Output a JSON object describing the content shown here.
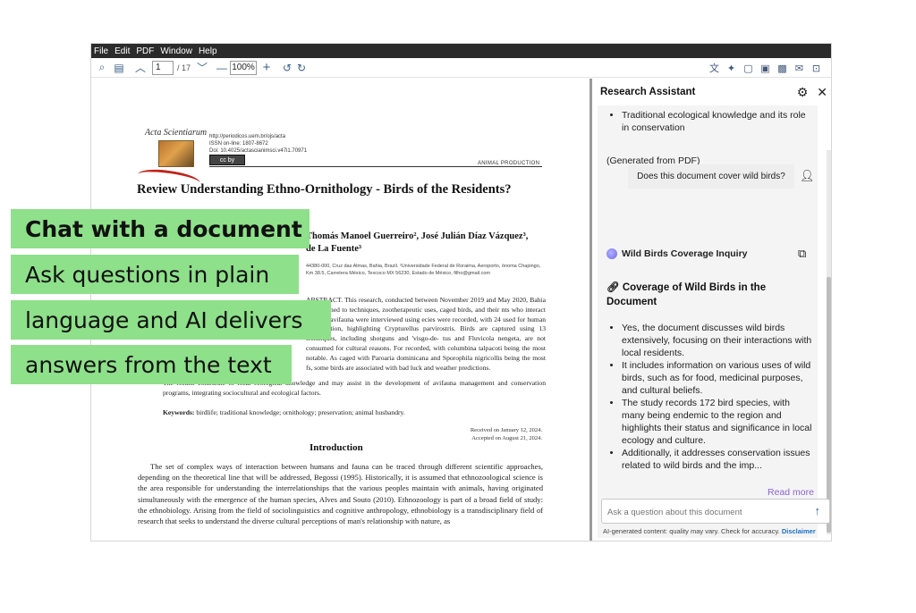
{
  "menu": [
    "File",
    "Edit",
    "PDF",
    "Window",
    "Help"
  ],
  "toolbar": {
    "page_current": "1",
    "page_total": "/ 17",
    "zoom": "100%"
  },
  "document": {
    "journal": "Acta Scientiarum",
    "meta_lines": [
      "http://periodicos.uem.br/ojs/acta",
      "ISSN on-line: 1807-8672",
      "Doi: 10.4025/actascianimsci.v47i1.70971"
    ],
    "cc_label": "cc  by",
    "section": "ANIMAL PRODUCTION",
    "title": "Review Understanding Ethno-Ornithology - Birds of the Residents?",
    "authors": "Thomás Manoel Guerreiro², José Julián Díaz Vázquez³, de La Fuente³",
    "affiliation": "44380-000, Cruz das Almas, Bahia, Brazil. ²Universidade Federal de Roraima, Aeroporto, ónoma Chapingo, Km 38.5, Carretera México, Texcoco MX 56230, Estado de México, filho@gmail.com",
    "abstract_partial": "ABSTRACT. This research, conducted between November 2019 and May 2020, Bahia State, aimed to techniques, zootherapeutic uses, caged birds, and their nts who interact with the avifauna were interviewed using ecies were recorded, with 24 used for human consumption, highlighting Crypturellus parvirostris. Birds are captured using 13 techniques, including shotguns and 'visgo-de- tus and Fluvicola nengeta, are not consumed for cultural reasons. For recorded, with columbina talpacoti being the most notable. As caged with Paroaria dominicana and Sporophila nigricollis being the most fs, some birds are associated with bad luck and weather predictions.",
    "abstract_end": "The results contribute to local ecological knowledge and may assist in the development of avifauna management and conservation programs, integrating sociocultural and ecological factors.",
    "keywords_label": "Keywords:",
    "keywords": "birdlife; traditional knowledge; ornithology; preservation; animal husbandry.",
    "received": "Received on January 12, 2024.",
    "accepted": "Accepted on August 21, 2024.",
    "intro_heading": "Introduction",
    "intro_body": "The set of complex ways of interaction between humans and fauna can be traced through different scientific approaches, depending on the theoretical line that will be addressed, Begossi (1995). Historically, it is assumed that ethnozoological science is the area responsible for understanding the interrelationships that the various peoples maintain with animals, having originated simultaneously with the emergence of the human species, Alves and Souto (2010). Ethnozoology is part of a broad field of study: the ethnobiology. Arising from the field of sociolinguistics and cognitive anthropology, ethnobiology is a transdisciplinary field of research that seeks to understand the diverse cultural perceptions of man's relationship with nature, as"
  },
  "overlay": {
    "line1": "Chat with a document",
    "line2": "Ask questions in plain",
    "line3": "language and AI delivers",
    "line4": "answers from the text"
  },
  "panel": {
    "title": "Research Assistant",
    "prev_bullet": "Traditional ecological knowledge and its role in conservation",
    "generated": "(Generated from PDF)",
    "user_question": "Does this document cover wild birds?",
    "answer_label": "Wild Birds Coverage Inquiry",
    "answer_title": "Coverage of Wild Birds in the Document",
    "bullets": [
      "Yes, the document discusses wild birds extensively, focusing on their interactions with local residents.",
      "It includes information on various uses of wild birds, such as for food, medicinal purposes, and cultural beliefs.",
      "The study records 172 bird species, with many being endemic to the region and highlights their status and significance in local ecology and culture.",
      "Additionally, it addresses conservation issues related to wild birds and the imp..."
    ],
    "read_more": "Read more",
    "input_placeholder": "Ask a question about this document",
    "disclaimer": "AI-generated content: quality may vary. Check for accuracy.",
    "disclaimer_link": "Disclaimer"
  }
}
